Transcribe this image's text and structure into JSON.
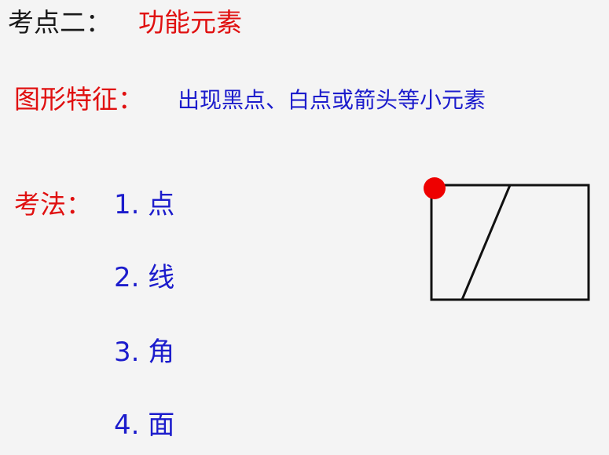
{
  "title": {
    "prefix": "考点二：",
    "topic": "功能元素"
  },
  "feature": {
    "label": "图形特征：",
    "text": "出现黑点、白点或箭头等小元素"
  },
  "method": {
    "label": "考法：",
    "items": [
      "1. 点",
      "2. 线",
      "3. 角",
      "4. 面"
    ]
  },
  "colors": {
    "background": "#f4f4f4",
    "heading_red": "#e01010",
    "body_blue": "#1c1ccc",
    "text_dark": "#1a1a1a",
    "dot_red": "#ee0000",
    "line_black": "#111111"
  }
}
